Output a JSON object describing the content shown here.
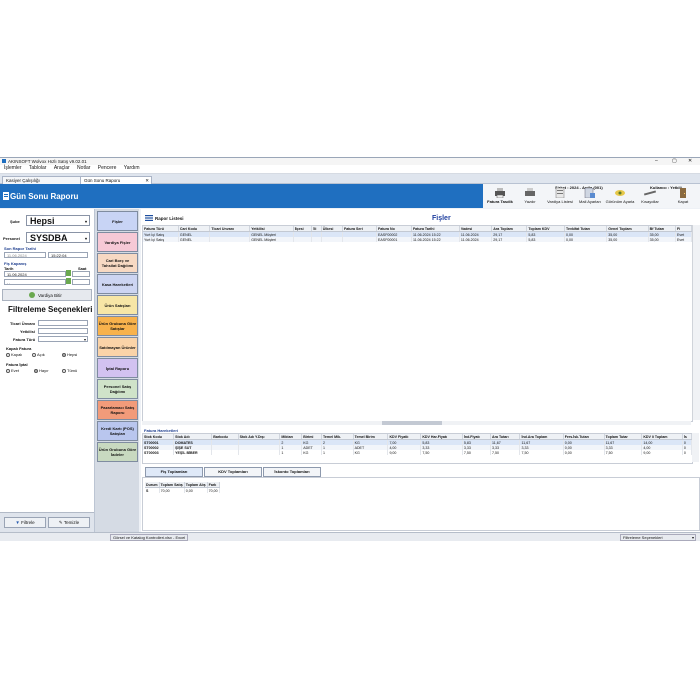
{
  "window": {
    "title": "AKINSOFT Wolvox Hızlı Satış v9.02.01",
    "menu": [
      "İşlemler",
      "Tablolar",
      "Araçlar",
      "Notlar",
      "Pencere",
      "Yardım"
    ],
    "tabs": [
      "Kasiyer Çalışılığı",
      "Gün Sonu Raporu"
    ],
    "company": "Şirket : 2024 - Arıtla (001)",
    "user": "Kullanıcı : Yetkili",
    "controls": {
      "min": "–",
      "max": "▢",
      "close": "✕"
    }
  },
  "header": {
    "title": "Gün Sonu Raporu"
  },
  "toolbar": [
    {
      "label": "Fatura Tasdik",
      "icon": "printer-icon"
    },
    {
      "label": "Yazdır",
      "icon": "printer-icon"
    },
    {
      "label": "Vardiya Listesi",
      "icon": "list-icon"
    },
    {
      "label": "Mail Ayarları",
      "icon": "mail-icon"
    },
    {
      "label": "Görünüm Ayarla",
      "icon": "eye-icon"
    },
    {
      "label": "Kısayollar",
      "icon": "key-icon"
    },
    {
      "label": "Kapat",
      "icon": "door-icon"
    }
  ],
  "filters": {
    "sube_label": "Şube",
    "sube_value": "Hepsi",
    "personel_label": "Personel",
    "personel_value": "SYSDBA",
    "son_rapor_label": "Son Rapor Tarihi",
    "son_rapor_date": "11.06.2024",
    "son_rapor_time": "15:22:04",
    "fis_kapanis_label": "Fiş Kapanış",
    "tarih_label": "Tarih",
    "saat_label": "Saat",
    "tarih_value": "11.06.2024",
    "tarih2_value": ". .",
    "vardiya_button": "Vardiya Bitir",
    "filtreleme_title": "Filtreleme Seçenekleri",
    "ticari_unvan_label": "Ticari Ünvanı",
    "yetkilisi_label": "Yetkilisi",
    "fatura_turu_label": "Fatura Türü",
    "kapali_fatura_label": "Kapalı Fatura",
    "kapali_options": [
      "Kapalı",
      "Açık",
      "Hepsi"
    ],
    "fatura_iptal_label": "Fatura İptal",
    "iptal_options": [
      "Evet",
      "Hayır",
      "Tümü"
    ],
    "filtrele_button": "Filtrele",
    "temizle_button": "Temizle"
  },
  "side_buttons": [
    {
      "label": "Fişler",
      "color": "#c8d4f5"
    },
    {
      "label": "Vardiya Fişler",
      "color": "#f7c9d6"
    },
    {
      "label": "Cari Borç ve Tahsilat Dağılımı",
      "color": "#f7d9c3"
    },
    {
      "label": "Kasa Hareketleri",
      "color": "#cdd5f2"
    },
    {
      "label": "Ürün Satışları",
      "color": "#f7e6a6"
    },
    {
      "label": "Ürün Grubuna Göre Satışlar",
      "color": "#f8b24c"
    },
    {
      "label": "Satılmayan Ürünler",
      "color": "#fad3a8"
    },
    {
      "label": "İptal Raporu",
      "color": "#d2c2f0"
    },
    {
      "label": "Personel Satış Dağılımı",
      "color": "#cfe3c9"
    },
    {
      "label": "Pazarlamacı Satış Raporu",
      "color": "#f29b7a"
    },
    {
      "label": "Kredi Kartı (POS) Satışları",
      "color": "#b9c6ee"
    },
    {
      "label": "Ürün Grubuna Göre İadeler",
      "color": "#c8d9c0"
    }
  ],
  "fisler": {
    "rapor_listesi": "Rapor Listesi",
    "title": "Fişler",
    "columns": [
      "Fatura Türü",
      "Cari Kodu",
      "Ticari Unvanı",
      "Yetkilisi",
      "İlçesi",
      "İli",
      "Ülkesi",
      "Fatura Seri",
      "Fatura No",
      "Fatura Tarihi",
      "Vadesi",
      "Ara Toplam",
      "Toplam KDV",
      "Tevkifat Tutarı",
      "Genel Toplam",
      "Bf Tutarı",
      "Fi"
    ],
    "rows": [
      [
        "Yurt İçi Satış",
        "GENEL",
        "",
        "GENEL Müşteri",
        "",
        "",
        "",
        "",
        "EASF00002",
        "11.06.2024 15:22",
        "11.06.2024",
        "29,17",
        "5,83",
        "0,00",
        "35,00",
        "35,00",
        "Evet"
      ],
      [
        "Yurt İçi Satış",
        "GENEL",
        "",
        "GENEL Müşteri",
        "",
        "",
        "",
        "",
        "EASF00001",
        "11.06.2024 15:22",
        "11.06.2024",
        "29,17",
        "5,83",
        "0,00",
        "35,00",
        "35,00",
        "Evet"
      ]
    ]
  },
  "hareketler": {
    "title": "Fatura Hareketleri",
    "columns": [
      "Stok Kodu",
      "Stok Adı",
      "Barkodu",
      "Stok Adı Y.Dışı",
      "Miktarı",
      "Birimi",
      "Temel Mik.",
      "Temel Birim",
      "KDV Fiyatlı",
      "KDV Har.Fiyatı",
      "İnd.Fiyatı",
      "Ara Tutarı",
      "İnd.Ara Toplam",
      "Fers.İsk.Tutarı",
      "Toplam Tutar",
      "KDV li Toplam",
      "İs"
    ],
    "rows": [
      [
        "ST00001",
        "DOMATES",
        "",
        "",
        "2",
        "KG",
        "2",
        "KG",
        "7,00",
        "5,83",
        "5,83",
        "11,67",
        "11,67",
        "0,00",
        "11,67",
        "14,00",
        "0"
      ],
      [
        "ST00002",
        "ŞİŞE SUT",
        "",
        "",
        "1",
        "ADET",
        "1",
        "ADET",
        "4,00",
        "3,33",
        "3,33",
        "3,33",
        "3,33",
        "0,00",
        "3,33",
        "4,00",
        "0"
      ],
      [
        "ST00003",
        "YEŞİL BİBER",
        "",
        "",
        "1",
        "KG",
        "1",
        "KG",
        "9,00",
        "7,50",
        "7,50",
        "7,50",
        "7,50",
        "0,00",
        "7,50",
        "9,00",
        "0"
      ]
    ]
  },
  "bottom_tabs": [
    "Fiş Toplamları",
    "KDV Toplamları",
    "İskonto Toplamları"
  ],
  "fis_toplam": {
    "columns": [
      "Durum",
      "Toplam Satış",
      "Toplam Alış",
      "Fark"
    ],
    "rows": [
      [
        "S",
        "70,00",
        "0,00",
        "70,00"
      ]
    ]
  },
  "status": {
    "task": "Görsel ve Katalog Kontrolleri.xlsx - Excel",
    "right": "Filtreleme Seçenekleri"
  }
}
